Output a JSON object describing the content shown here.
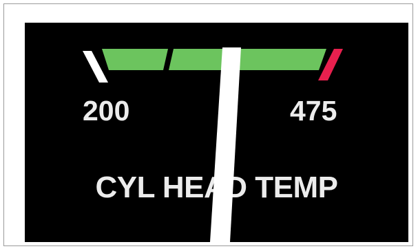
{
  "gauge": {
    "title": "CYL HEAD TEMP",
    "scale_min_label": "200",
    "scale_max_label": "475",
    "scale_min": 200,
    "scale_max": 475,
    "pointer_value": 357,
    "colors": {
      "background": "#000000",
      "frame": "#ffffff",
      "normal_range": "#6cc45e",
      "caution_limit": "#e8204e",
      "min_limit": "#ffffff",
      "pointer": "#ffffff",
      "text": "#ececec"
    }
  }
}
